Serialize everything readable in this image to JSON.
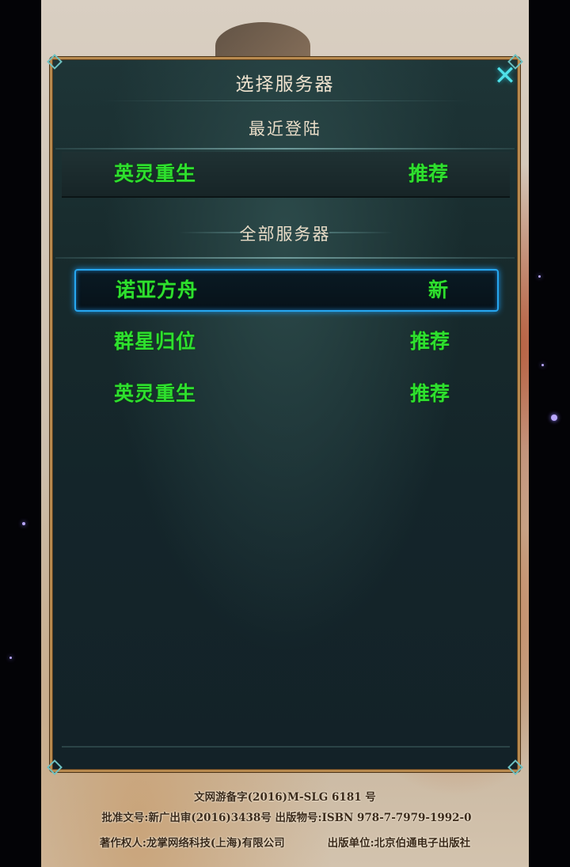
{
  "dialog": {
    "title": "选择服务器",
    "close_icon": "close-icon"
  },
  "recent": {
    "section_title": "最近登陆",
    "server": {
      "name": "英灵重生",
      "status": "推荐"
    }
  },
  "all_servers": {
    "section_title": "全部服务器",
    "selected_index": 0,
    "items": [
      {
        "name": "诺亚方舟",
        "status": "新"
      },
      {
        "name": "群星归位",
        "status": "推荐"
      },
      {
        "name": "英灵重生",
        "status": "推荐"
      }
    ]
  },
  "footer": {
    "line1": "文网游备字(2016)M-SLG 6181 号",
    "line2": "批准文号:新广出审(2016)3438号   出版物号:ISBN 978-7-7979-1992-0",
    "line3_left": "著作权人:龙掌网络科技(上海)有限公司",
    "line3_right": "出版单位:北京伯通电子出版社"
  },
  "colors": {
    "server_text": "#2ee02e",
    "selected_border": "#26a7f0",
    "panel_border": "#b88a4f",
    "close_icon": "#4fe0e8"
  }
}
